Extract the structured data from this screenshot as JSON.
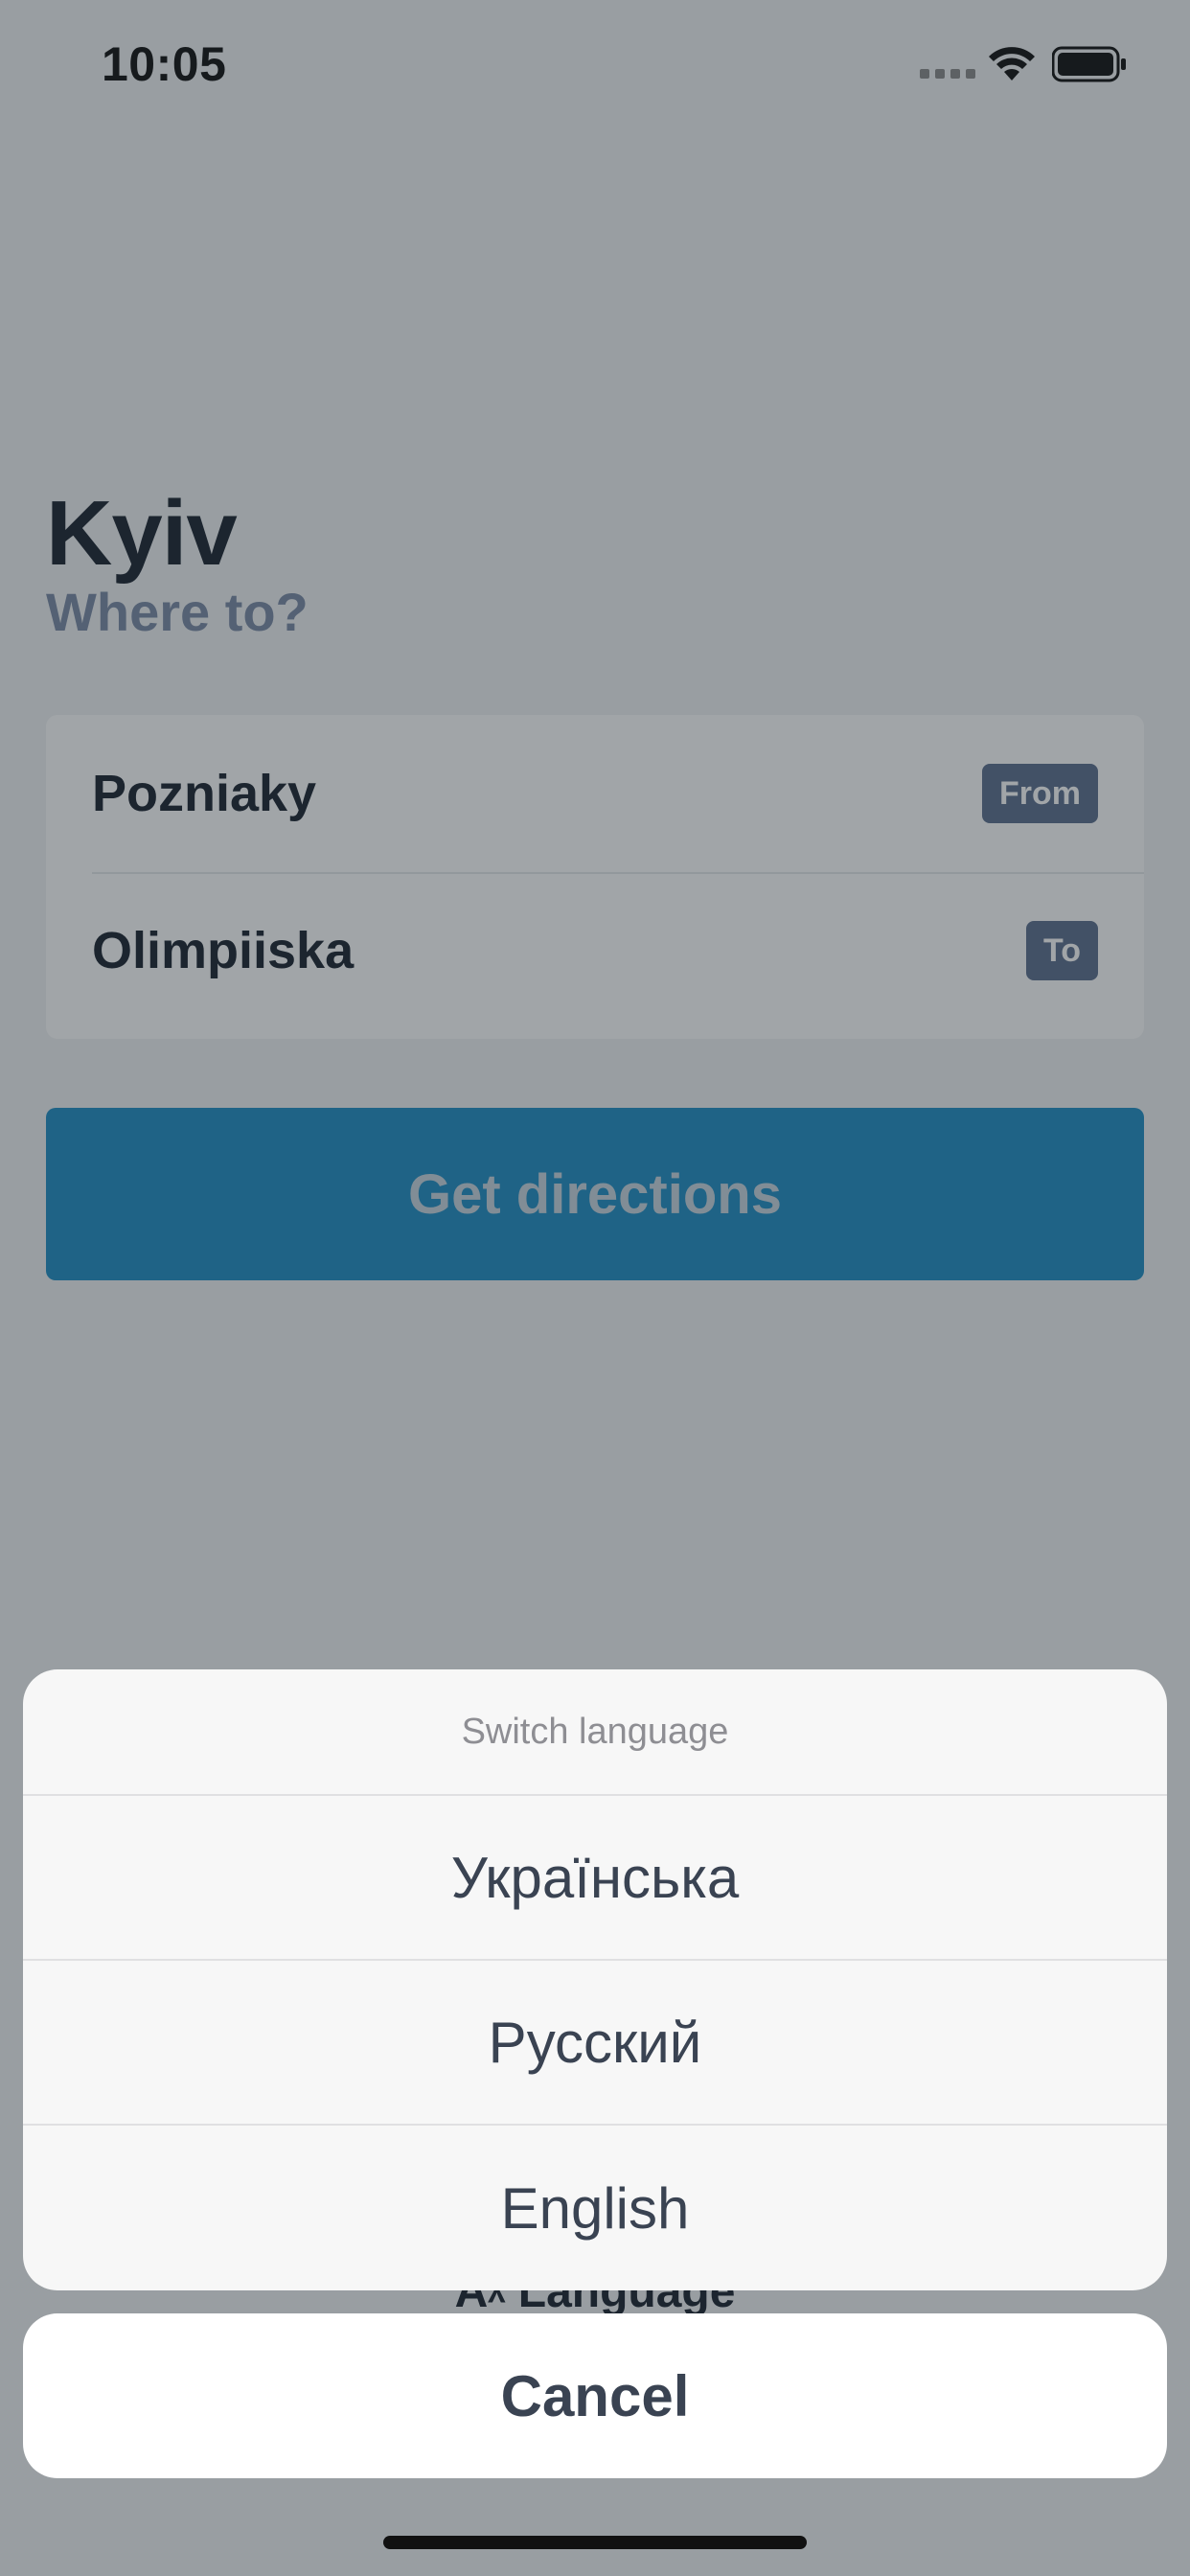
{
  "status_bar": {
    "time": "10:05"
  },
  "header": {
    "city": "Kyiv",
    "subtitle": "Where to?"
  },
  "route": {
    "from_place": "Pozniaky",
    "from_tag": "From",
    "to_place": "Olimpiiska",
    "to_tag": "To"
  },
  "actions": {
    "get_directions_label": "Get directions",
    "language_label": "Aᵡ Language"
  },
  "language_sheet": {
    "title": "Switch language",
    "options": [
      "Українська",
      "Русский",
      "English"
    ],
    "cancel_label": "Cancel"
  },
  "colors": {
    "accent": "#1f8ec4",
    "tag": "#5c6e8e"
  }
}
